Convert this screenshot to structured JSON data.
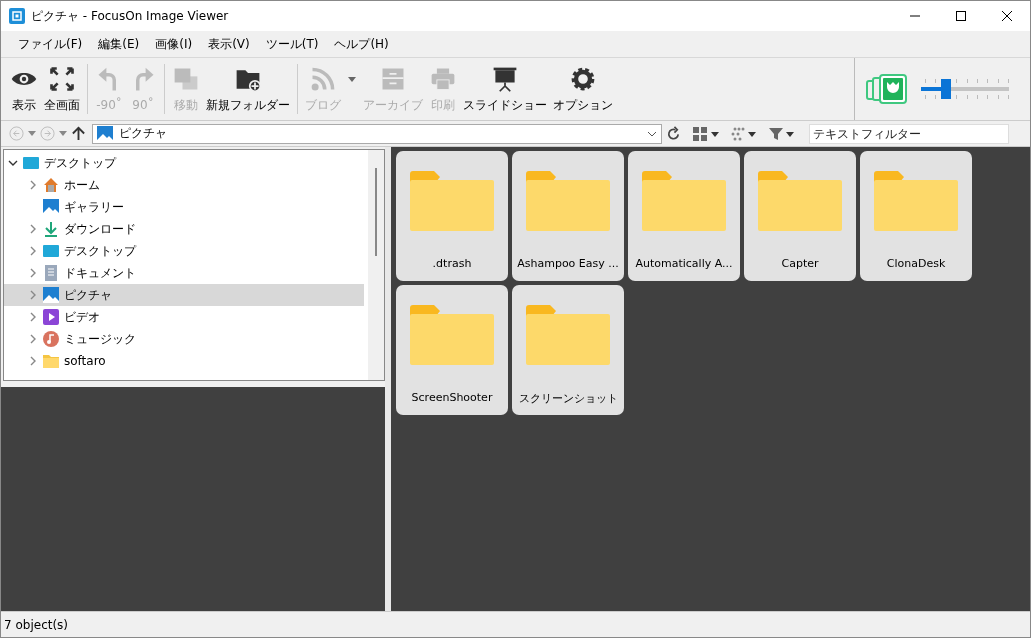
{
  "window": {
    "title": "ピクチャ - FocusOn Image Viewer"
  },
  "menu": [
    "ファイル(F)",
    "編集(E)",
    "画像(I)",
    "表示(V)",
    "ツール(T)",
    "ヘルプ(H)"
  ],
  "toolbar": {
    "groups": [
      [
        {
          "label": "表示",
          "disabled": false
        },
        {
          "label": "全画面",
          "disabled": false
        }
      ],
      [
        {
          "label": "-90˚",
          "disabled": true
        },
        {
          "label": "90˚",
          "disabled": true
        }
      ],
      [
        {
          "label": "移動",
          "disabled": true
        },
        {
          "label": "新規フォルダー",
          "disabled": false
        }
      ],
      [
        {
          "label": "ブログ",
          "disabled": true,
          "dropdown": true
        },
        {
          "label": "アーカイブ",
          "disabled": true
        },
        {
          "label": "印刷",
          "disabled": true
        },
        {
          "label": "スライドショー",
          "disabled": false
        },
        {
          "label": "オプション",
          "disabled": false
        }
      ]
    ],
    "zoom": {
      "level": 0.3
    }
  },
  "address": {
    "path": "ピクチャ",
    "filter_placeholder": "テキストフィルター"
  },
  "tree": {
    "label": "デスクトップ",
    "expanded": true,
    "children": [
      {
        "label": "ホーム",
        "expandable": true,
        "selected": false
      },
      {
        "label": "ギャラリー",
        "expandable": false,
        "selected": false
      },
      {
        "label": "ダウンロード",
        "expandable": true,
        "selected": false
      },
      {
        "label": "デスクトップ",
        "expandable": true,
        "selected": false
      },
      {
        "label": "ドキュメント",
        "expandable": true,
        "selected": false
      },
      {
        "label": "ピクチャ",
        "expandable": true,
        "selected": true
      },
      {
        "label": "ビデオ",
        "expandable": true,
        "selected": false
      },
      {
        "label": "ミュージック",
        "expandable": true,
        "selected": false
      },
      {
        "label": "softaro",
        "expandable": true,
        "selected": false
      }
    ]
  },
  "folders": [
    ".dtrash",
    "Ashampoo Easy ...",
    "Automatically A...",
    "Capter",
    "ClonaDesk",
    "ScreenShooter",
    "スクリーンショット"
  ],
  "status_bar": "7 object(s)"
}
